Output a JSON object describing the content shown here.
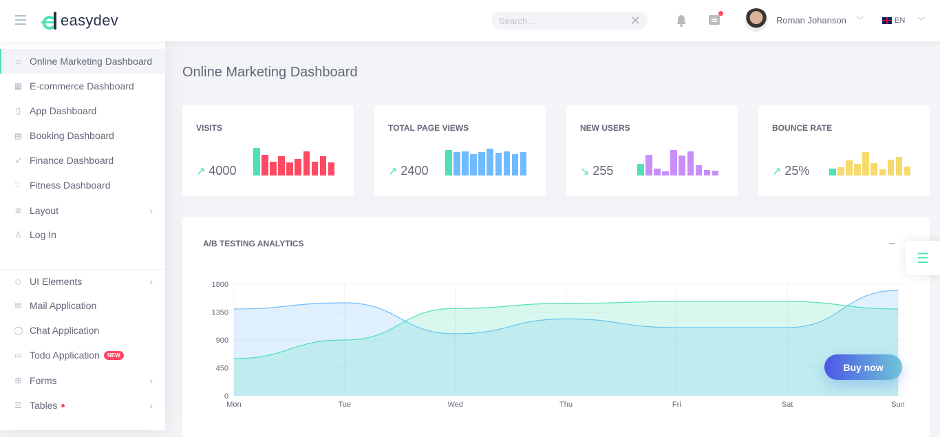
{
  "header": {
    "brand": "easydev",
    "search_placeholder": "Search...",
    "user_name": "Roman Johanson",
    "language": "EN"
  },
  "sidebar": {
    "items": [
      {
        "label": "Online Marketing Dashboard",
        "icon": "home-icon",
        "active": true
      },
      {
        "label": "E-commerce Dashboard",
        "icon": "store-icon"
      },
      {
        "label": "App Dashboard",
        "icon": "phone-icon"
      },
      {
        "label": "Booking Dashboard",
        "icon": "apartment-icon"
      },
      {
        "label": "Finance Dashboard",
        "icon": "rocket-icon"
      },
      {
        "label": "Fitness Dashboard",
        "icon": "heart-pulse-icon"
      },
      {
        "label": "Layout",
        "icon": "layers-icon",
        "arrow": true
      },
      {
        "label": "Log In",
        "icon": "user-icon"
      },
      {
        "label": "UI Elements",
        "icon": "diamond-icon",
        "arrow": true
      },
      {
        "label": "Mail Application",
        "icon": "envelope-icon"
      },
      {
        "label": "Chat Application",
        "icon": "bubble-icon"
      },
      {
        "label": "Todo Application",
        "icon": "book-icon",
        "badge": "NEW"
      },
      {
        "label": "Forms",
        "icon": "file-add-icon",
        "arrow": true
      },
      {
        "label": "Tables",
        "icon": "list-icon",
        "arrow": true,
        "dot": true
      }
    ]
  },
  "page_title": "Online Marketing Dashboard",
  "cards": [
    {
      "title": "VISITS",
      "value": "4000",
      "trend": "up",
      "color": "#ff4861",
      "bars": [
        40,
        30,
        20,
        28,
        19,
        24,
        35,
        20,
        28,
        19
      ]
    },
    {
      "title": "TOTAL PAGE VIEWS",
      "value": "2400",
      "trend": "up",
      "color": "#70bbfd",
      "bars": [
        37,
        34,
        35,
        31,
        34,
        39,
        33,
        35,
        31,
        34
      ]
    },
    {
      "title": "NEW USERS",
      "value": "255",
      "trend": "down",
      "color": "#c88ffa",
      "bars": [
        17,
        30,
        10,
        6,
        37,
        29,
        35,
        15,
        8,
        7
      ]
    },
    {
      "title": "BOUNCE RATE",
      "value": "25%",
      "trend": "up",
      "color": "#f6da6e",
      "bars": [
        10,
        12,
        22,
        17,
        34,
        18,
        9,
        23,
        27,
        13
      ]
    }
  ],
  "accent": "#4ce1b6",
  "ab": {
    "title": "A/B TESTING ANALYTICS"
  },
  "chart_data": {
    "type": "area",
    "categories": [
      "Mon",
      "Tue",
      "Wed",
      "Thu",
      "Fri",
      "Sat",
      "Sun"
    ],
    "series": [
      {
        "color": "#70bbfd",
        "values": [
          1400,
          1500,
          1000,
          1240,
          1100,
          1100,
          1700
        ]
      },
      {
        "color": "#4ce1b6",
        "values": [
          600,
          900,
          1410,
          1490,
          1520,
          1520,
          1400
        ]
      }
    ],
    "ylim": [
      0,
      1800
    ],
    "yticks": [
      "0",
      "450",
      "900",
      "1350",
      "1800"
    ],
    "grid": true
  },
  "buy_now": "Buy now"
}
